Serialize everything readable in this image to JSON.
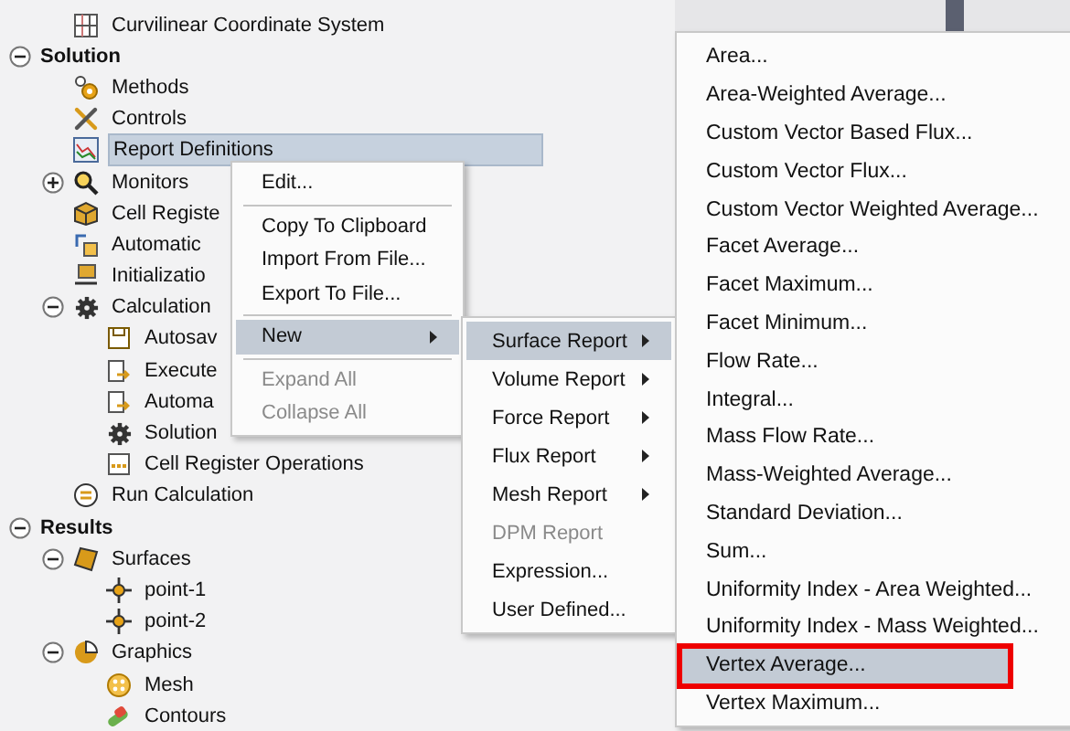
{
  "tree": [
    {
      "children": [
        {
          "label": "Curvilinear Coordinate System",
          "kind": "grid",
          "selected": false
        }
      ]
    },
    {
      "label": "Solution",
      "kind": "none",
      "expanded": true,
      "selected": false,
      "children": [
        {
          "label": "Methods",
          "kind": "methods",
          "selected": false
        },
        {
          "label": "Controls",
          "kind": "controls",
          "selected": false
        },
        {
          "label": "Report Definitions",
          "kind": "report",
          "selected": true
        },
        {
          "label": "Monitors",
          "kind": "monitor",
          "expanded": false,
          "selected": false
        },
        {
          "label": "Cell Registe",
          "kind": "cube",
          "selected": false
        },
        {
          "label": "Automatic",
          "kind": "automatic",
          "selected": false
        },
        {
          "label": "Initializatio",
          "kind": "init",
          "selected": false
        },
        {
          "label": "Calculation",
          "kind": "gear",
          "expanded": true,
          "selected": false,
          "children": [
            {
              "label": "Autosav",
              "kind": "file",
              "selected": false
            },
            {
              "label": "Execute",
              "kind": "file-arrow",
              "selected": false
            },
            {
              "label": "Automa",
              "kind": "file-arrow",
              "selected": false
            },
            {
              "label": "Solution",
              "kind": "gear",
              "selected": false
            },
            {
              "label": "Cell Register Operations",
              "kind": "sheet",
              "selected": false
            }
          ]
        },
        {
          "label": "Run Calculation",
          "kind": "run",
          "selected": false
        }
      ]
    },
    {
      "label": "Results",
      "kind": "none",
      "expanded": true,
      "selected": false,
      "children": [
        {
          "label": "Surfaces",
          "kind": "surface",
          "expanded": true,
          "selected": false,
          "children": [
            {
              "label": "point-1",
              "kind": "point",
              "selected": false
            },
            {
              "label": "point-2",
              "kind": "point",
              "selected": false
            }
          ]
        },
        {
          "label": "Graphics",
          "kind": "graphics",
          "expanded": true,
          "selected": false,
          "children": [
            {
              "label": "Mesh",
              "kind": "mesh",
              "selected": false
            },
            {
              "label": "Contours",
              "kind": "contours",
              "selected": false
            }
          ]
        }
      ]
    }
  ],
  "context_menu": [
    {
      "kind": "item",
      "label": "Edit...",
      "selected": false,
      "disabled": false,
      "submenu": false
    },
    {
      "kind": "separator"
    },
    {
      "kind": "item",
      "label": "Copy To Clipboard",
      "selected": false,
      "disabled": false,
      "submenu": false
    },
    {
      "kind": "item",
      "label": "Import From File...",
      "selected": false,
      "disabled": false,
      "submenu": false
    },
    {
      "kind": "item",
      "label": "Export To File...",
      "selected": false,
      "disabled": false,
      "submenu": false
    },
    {
      "kind": "separator"
    },
    {
      "kind": "item",
      "label": "New",
      "selected": true,
      "disabled": false,
      "submenu": true
    },
    {
      "kind": "separator"
    },
    {
      "kind": "item",
      "label": "Expand All",
      "selected": false,
      "disabled": true,
      "submenu": false
    },
    {
      "kind": "item",
      "label": "Collapse All",
      "selected": false,
      "disabled": true,
      "submenu": false
    }
  ],
  "new_menu": [
    {
      "kind": "item",
      "label": "Surface Report",
      "selected": true,
      "disabled": false,
      "submenu": true
    },
    {
      "kind": "item",
      "label": "Volume Report",
      "selected": false,
      "disabled": false,
      "submenu": true
    },
    {
      "kind": "item",
      "label": "Force Report",
      "selected": false,
      "disabled": false,
      "submenu": true
    },
    {
      "kind": "item",
      "label": "Flux Report",
      "selected": false,
      "disabled": false,
      "submenu": true
    },
    {
      "kind": "item",
      "label": "Mesh Report",
      "selected": false,
      "disabled": false,
      "submenu": true
    },
    {
      "kind": "item",
      "label": "DPM Report",
      "selected": false,
      "disabled": true,
      "submenu": false
    },
    {
      "kind": "item",
      "label": "Expression...",
      "selected": false,
      "disabled": false,
      "submenu": false
    },
    {
      "kind": "item",
      "label": "User Defined...",
      "selected": false,
      "disabled": false,
      "submenu": false
    }
  ],
  "surface_report_menu": [
    {
      "kind": "item",
      "label": "Area...",
      "selected": false,
      "annotated": false
    },
    {
      "kind": "item",
      "label": "Area-Weighted Average...",
      "selected": false,
      "annotated": false
    },
    {
      "kind": "item",
      "label": "Custom Vector Based Flux...",
      "selected": false,
      "annotated": false
    },
    {
      "kind": "item",
      "label": "Custom Vector Flux...",
      "selected": false,
      "annotated": false
    },
    {
      "kind": "item",
      "label": "Custom Vector Weighted Average...",
      "selected": false,
      "annotated": false
    },
    {
      "kind": "item",
      "label": "Facet Average...",
      "selected": false,
      "annotated": false
    },
    {
      "kind": "item",
      "label": "Facet Maximum...",
      "selected": false,
      "annotated": false
    },
    {
      "kind": "item",
      "label": "Facet Minimum...",
      "selected": false,
      "annotated": false
    },
    {
      "kind": "item",
      "label": "Flow Rate...",
      "selected": false,
      "annotated": false
    },
    {
      "kind": "item",
      "label": "Integral...",
      "selected": false,
      "annotated": false
    },
    {
      "kind": "item",
      "label": "Mass Flow Rate...",
      "selected": false,
      "annotated": false
    },
    {
      "kind": "item",
      "label": "Mass-Weighted Average...",
      "selected": false,
      "annotated": false
    },
    {
      "kind": "item",
      "label": "Standard Deviation...",
      "selected": false,
      "annotated": false
    },
    {
      "kind": "item",
      "label": "Sum...",
      "selected": false,
      "annotated": false
    },
    {
      "kind": "item",
      "label": "Uniformity Index - Area Weighted...",
      "selected": false,
      "annotated": false
    },
    {
      "kind": "item",
      "label": "Uniformity Index - Mass Weighted...",
      "selected": false,
      "annotated": false
    },
    {
      "kind": "item",
      "label": "Vertex Average...",
      "selected": true,
      "annotated": true
    },
    {
      "kind": "item",
      "label": "Vertex Maximum...",
      "selected": false,
      "annotated": false
    }
  ]
}
